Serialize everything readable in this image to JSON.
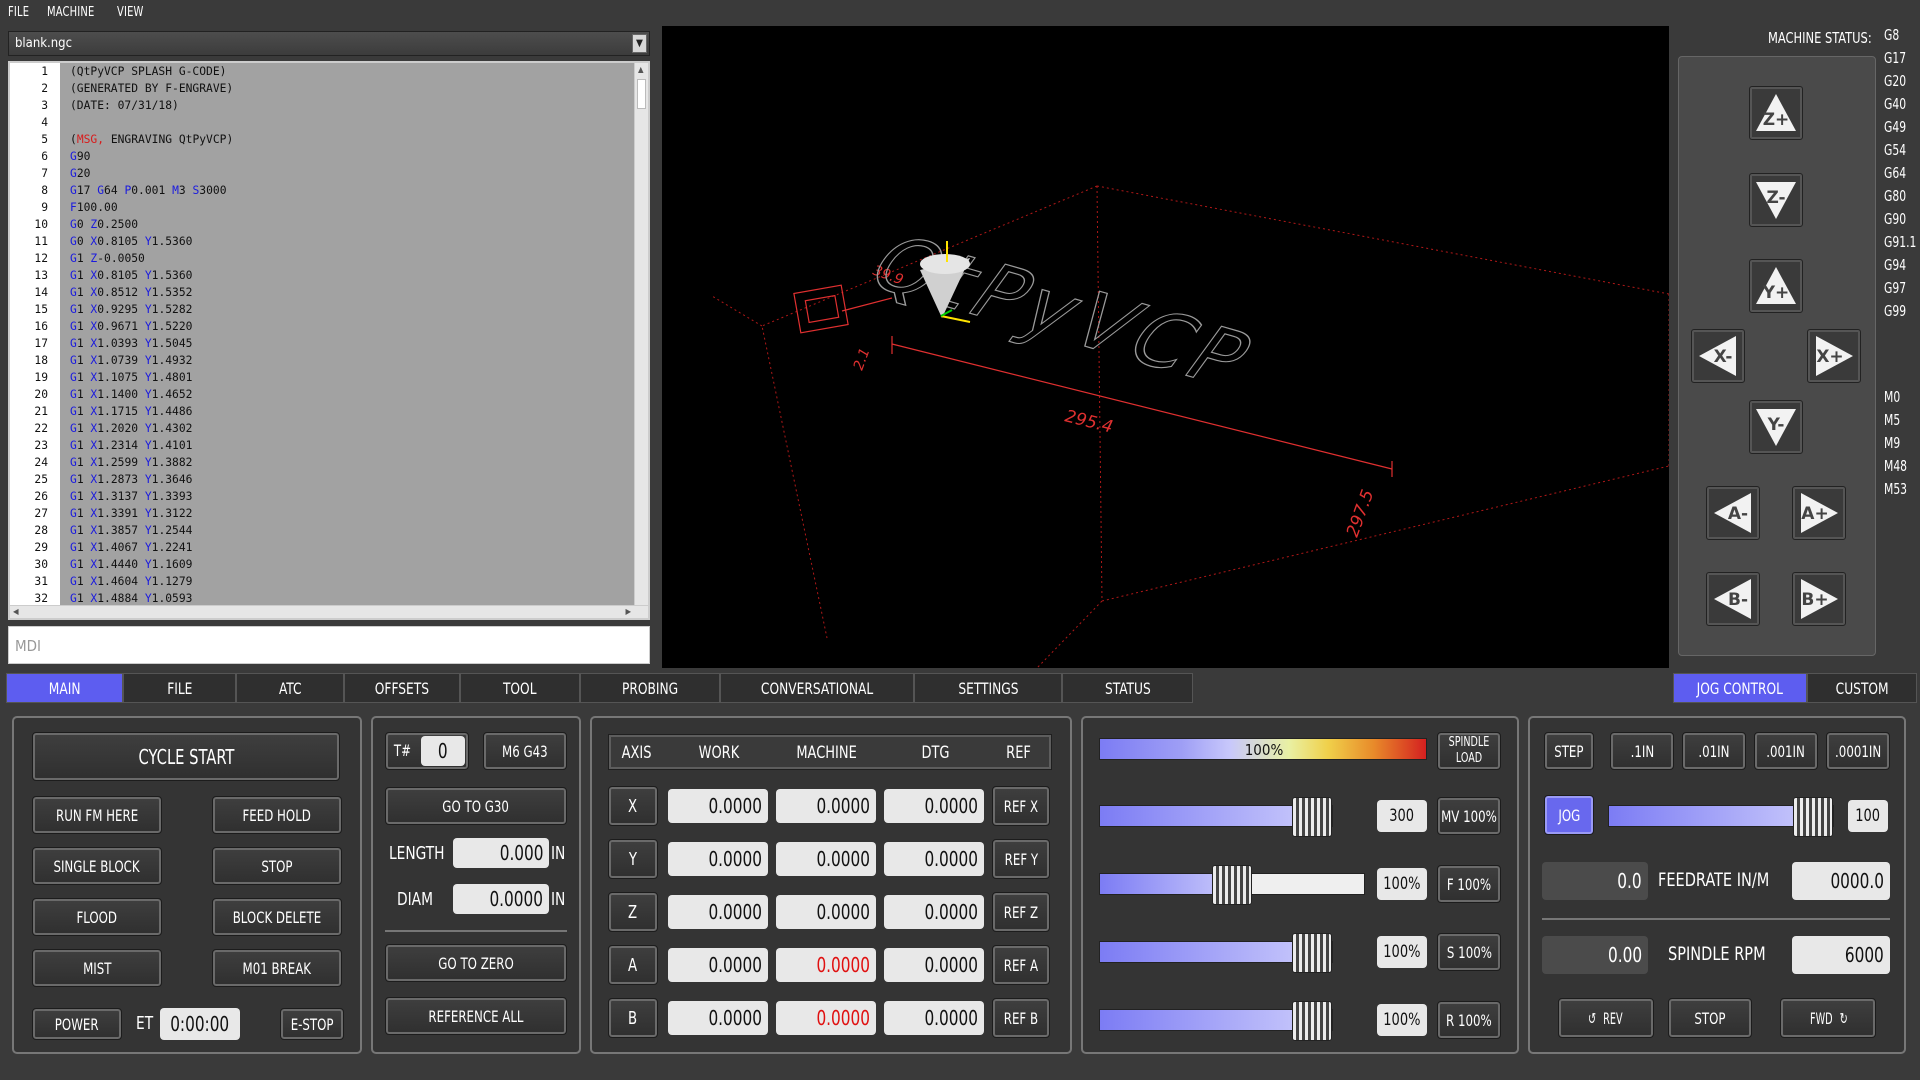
{
  "menu": [
    "FILE",
    "MACHINE",
    "VIEW"
  ],
  "file_combo": {
    "value": "blank.ngc"
  },
  "editor": {
    "lines": [
      {
        "n": "1",
        "t": "(QtPyVCP SPLASH G-CODE)"
      },
      {
        "n": "2",
        "t": "(GENERATED BY F-ENGRAVE)"
      },
      {
        "n": "3",
        "t": "(DATE: 07/31/18)"
      },
      {
        "n": "4",
        "t": ""
      },
      {
        "n": "5",
        "t": "(MSG, ENGRAVING QtPyVCP)"
      },
      {
        "n": "6",
        "t": "G90"
      },
      {
        "n": "7",
        "t": "G20"
      },
      {
        "n": "8",
        "t": "G17 G64 P0.001 M3 S3000"
      },
      {
        "n": "9",
        "t": "F100.00"
      },
      {
        "n": "10",
        "t": "G0 Z0.2500"
      },
      {
        "n": "11",
        "t": "G0 X0.8105 Y1.5360"
      },
      {
        "n": "12",
        "t": "G1 Z-0.0050"
      },
      {
        "n": "13",
        "t": "G1 X0.8105 Y1.5360"
      },
      {
        "n": "14",
        "t": "G1 X0.8512 Y1.5352"
      },
      {
        "n": "15",
        "t": "G1 X0.9295 Y1.5282"
      },
      {
        "n": "16",
        "t": "G1 X0.9671 Y1.5220"
      },
      {
        "n": "17",
        "t": "G1 X1.0393 Y1.5045"
      },
      {
        "n": "18",
        "t": "G1 X1.0739 Y1.4932"
      },
      {
        "n": "19",
        "t": "G1 X1.1075 Y1.4801"
      },
      {
        "n": "20",
        "t": "G1 X1.1400 Y1.4652"
      },
      {
        "n": "21",
        "t": "G1 X1.1715 Y1.4486"
      },
      {
        "n": "22",
        "t": "G1 X1.2020 Y1.4302"
      },
      {
        "n": "23",
        "t": "G1 X1.2314 Y1.4101"
      },
      {
        "n": "24",
        "t": "G1 X1.2599 Y1.3882"
      },
      {
        "n": "25",
        "t": "G1 X1.2873 Y1.3646"
      },
      {
        "n": "26",
        "t": "G1 X1.3137 Y1.3393"
      },
      {
        "n": "27",
        "t": "G1 X1.3391 Y1.3122"
      },
      {
        "n": "28",
        "t": "G1 X1.3857 Y1.2544"
      },
      {
        "n": "29",
        "t": "G1 X1.4067 Y1.2241"
      },
      {
        "n": "30",
        "t": "G1 X1.4440 Y1.1609"
      },
      {
        "n": "31",
        "t": "G1 X1.4604 Y1.1279"
      },
      {
        "n": "32",
        "t": "G1 X1.4884 Y1.0593"
      }
    ]
  },
  "mdi": {
    "placeholder": "MDI"
  },
  "viewport": {
    "dims": {
      "d1": "39.9",
      "d2": "2.1",
      "d3": "295.4",
      "d4": "297.5"
    },
    "text": "QtPyVCP"
  },
  "machine_status": {
    "title": "MACHINE STATUS:",
    "gcodes": [
      "G8",
      "G17",
      "G20",
      "G40",
      "G49",
      "G54",
      "G64",
      "G80",
      "G90",
      "G91.1",
      "G94",
      "G97",
      "G99"
    ],
    "mcodes": [
      "M0",
      "M5",
      "M9",
      "M48",
      "M53"
    ]
  },
  "jog": {
    "zplus": "Z+",
    "zminus": "Z-",
    "yplus": "Y+",
    "yminus": "Y-",
    "xminus": "X-",
    "xplus": "X+",
    "aminus": "A-",
    "aplus": "A+",
    "bminus": "B-",
    "bplus": "B+"
  },
  "tabs": [
    "MAIN",
    "FILE",
    "ATC",
    "OFFSETS",
    "TOOL",
    "PROBING",
    "CONVERSATIONAL",
    "SETTINGS",
    "STATUS"
  ],
  "right_tabs": [
    "JOG CONTROL",
    "CUSTOM"
  ],
  "program": {
    "cycle_start": "CYCLE START",
    "run_from_here": "RUN FM HERE",
    "feed_hold": "FEED HOLD",
    "single_block": "SINGLE BLOCK",
    "stop": "STOP",
    "flood": "FLOOD",
    "block_delete": "BLOCK DELETE",
    "mist": "MIST",
    "m01_break": "M01 BREAK",
    "power": "POWER",
    "et_label": "ET",
    "et_value": "0:00:00",
    "estop": "E-STOP"
  },
  "tool": {
    "t_label": "T#",
    "t_value": "0",
    "m6_button": "M6 G43",
    "goto_g30": "GO TO G30",
    "length_label": "LENGTH",
    "length_value": "0.000",
    "length_unit": "IN",
    "diam_label": "DIAM",
    "diam_value": "0.0000",
    "diam_unit": "IN",
    "goto_zero": "GO TO ZERO",
    "reference_all": "REFERENCE ALL"
  },
  "dro": {
    "headers": [
      "AXIS",
      "WORK",
      "MACHINE",
      "DTG",
      "REF"
    ],
    "rows": [
      {
        "axis": "X",
        "work": "0.0000",
        "machine": "0.0000",
        "dtg": "0.0000",
        "ref": "REF X"
      },
      {
        "axis": "Y",
        "work": "0.0000",
        "machine": "0.0000",
        "dtg": "0.0000",
        "ref": "REF Y"
      },
      {
        "axis": "Z",
        "work": "0.0000",
        "machine": "0.0000",
        "dtg": "0.0000",
        "ref": "REF Z"
      },
      {
        "axis": "A",
        "work": "0.0000",
        "machine": "0.0000",
        "dtg": "0.0000",
        "ref": "REF A"
      },
      {
        "axis": "B",
        "work": "0.0000",
        "machine": "0.0000",
        "dtg": "0.0000",
        "ref": "REF B"
      }
    ],
    "unhomed_color": "#e01010"
  },
  "overrides": {
    "spindle_load": {
      "value": "100%",
      "label": "SPINDLE LOAD",
      "level": 1.0
    },
    "max_velocity": {
      "value": "300",
      "button": "MV 100%",
      "level": 1.0
    },
    "feed": {
      "value": "100%",
      "button": "F 100%",
      "level": 0.5
    },
    "spindle": {
      "value": "100%",
      "button": "S 100%",
      "level": 1.0
    },
    "rapid": {
      "value": "100%",
      "button": "R 100%",
      "level": 1.0
    }
  },
  "jog_control": {
    "step_label": "STEP",
    "increments": [
      ".1IN",
      ".01IN",
      ".001IN",
      ".0001IN"
    ],
    "jog_button": "JOG",
    "jog_value": "100",
    "jog_level": 1.0,
    "feed_actual": "0.0",
    "feed_label": "FEEDRATE IN/M",
    "feed_value": "0000.0",
    "rpm_actual": "0.00",
    "rpm_label": "SPINDLE RPM",
    "rpm_value": "6000",
    "rev": "REV",
    "stop": "STOP",
    "fwd": "FWD"
  },
  "colors": {
    "accent": "#6868ee",
    "panel": "#343434",
    "red": "#e01010"
  }
}
